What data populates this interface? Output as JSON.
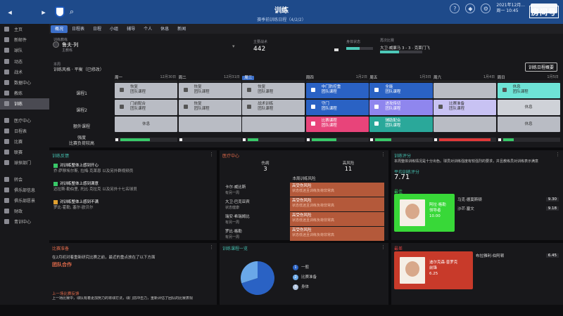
{
  "topbar": {
    "title": "训练",
    "subtitle": "赛季前训练日程（4/2/2）",
    "date_line1": "2021年12月...",
    "date_line2": "周一 10:45"
  },
  "watermark": {
    "line1": "房间号",
    "line2": "10298082"
  },
  "sidebar": {
    "items": [
      {
        "label": "主页",
        "active": false
      },
      {
        "label": "新邮件",
        "active": false
      },
      {
        "label": "球队",
        "active": false
      },
      {
        "label": "动态",
        "active": false
      },
      {
        "label": "战术",
        "active": false
      },
      {
        "label": "数据中心",
        "active": false
      },
      {
        "label": "教练",
        "active": false
      },
      {
        "label": "训练",
        "active": true
      },
      {
        "label": "医疗中心",
        "active": false
      },
      {
        "label": "日程表",
        "active": false
      },
      {
        "label": "比赛",
        "active": false
      },
      {
        "label": "联赛",
        "active": false
      },
      {
        "label": "球探部门",
        "active": false
      },
      {
        "label": "转会",
        "active": false
      },
      {
        "label": "俱乐部信息",
        "active": false
      },
      {
        "label": "俱乐部愿景",
        "active": false
      },
      {
        "label": "财政",
        "active": false
      },
      {
        "label": "青训中心",
        "active": false
      }
    ]
  },
  "tabs": [
    "概况",
    "日程表",
    "日程",
    "小组",
    "辅导",
    "个人",
    "休息",
    "新闻"
  ],
  "info": {
    "coach_label": "训练教练",
    "coach_name": "鲁夫·列",
    "coach_role": "主教练",
    "stars_label": "主要战术",
    "stars_value": "442",
    "cond_label": "身体状态",
    "match_label": "再次比赛",
    "match_text": "大卫·威廉马 3 - 3 · 克莱门飞",
    "match_score": "3 - 3"
  },
  "schedule": {
    "section_label": "本周",
    "title": "训练风格 · 平衡（已修改）",
    "calendar_button": "训练日程概要",
    "rows": [
      "课程1",
      "课程2",
      "额外课程"
    ],
    "intensity_label": "强度",
    "intensity_sub": "比赛负荷较高",
    "days": [
      {
        "name": "周一",
        "date": "12月30日",
        "today": false
      },
      {
        "name": "周二",
        "date": "12月31日",
        "today": false
      },
      {
        "name": "周三",
        "date": "",
        "today": true
      },
      {
        "name": "周四",
        "date": "1月2日",
        "today": false
      },
      {
        "name": "周五",
        "date": "1月3日",
        "today": false
      },
      {
        "name": "周六",
        "date": "1月4日",
        "today": false
      },
      {
        "name": "周日",
        "date": "1月5日",
        "today": false
      }
    ],
    "sessions": [
      {
        "row": 0,
        "day": 0,
        "style": "grey",
        "l1": "恢复",
        "l2": "团队课程"
      },
      {
        "row": 0,
        "day": 1,
        "style": "grey",
        "l1": "恢复",
        "l2": "团队课程"
      },
      {
        "row": 0,
        "day": 2,
        "style": "grey",
        "l1": "恢复",
        "l2": "团队课程"
      },
      {
        "row": 0,
        "day": 3,
        "style": "blue",
        "l1": "中门防控重",
        "l2": "团队课程"
      },
      {
        "row": 0,
        "day": 4,
        "style": "blue",
        "l1": "全能",
        "l2": "团队课程"
      },
      {
        "row": 0,
        "day": 5,
        "style": "grey",
        "l1": "",
        "l2": ""
      },
      {
        "row": 0,
        "day": 6,
        "style": "cyan",
        "l1": "休息",
        "l2": "团队课程"
      },
      {
        "row": 1,
        "day": 0,
        "style": "grey",
        "l1": "门前配合",
        "l2": "团队课程"
      },
      {
        "row": 1,
        "day": 1,
        "style": "grey",
        "l1": "恢复",
        "l2": "团队课程"
      },
      {
        "row": 1,
        "day": 2,
        "style": "grey",
        "l1": "战术训练",
        "l2": "团队课程"
      },
      {
        "row": 1,
        "day": 3,
        "style": "blue",
        "l1": "守门",
        "l2": "团队课程"
      },
      {
        "row": 1,
        "day": 4,
        "style": "lilac",
        "l1": "进攻传切",
        "l2": "团队课程"
      },
      {
        "row": 1,
        "day": 5,
        "style": "lavender",
        "l1": "比赛准备",
        "l2": "团队课程"
      },
      {
        "row": 1,
        "day": 6,
        "style": "lightgrey",
        "l1": "休息",
        "l2": ""
      },
      {
        "row": 2,
        "day": 0,
        "style": "grey",
        "l1": "休息",
        "l2": ""
      },
      {
        "row": 2,
        "day": 1,
        "style": "grey",
        "l1": "",
        "l2": ""
      },
      {
        "row": 2,
        "day": 2,
        "style": "grey",
        "l1": "",
        "l2": ""
      },
      {
        "row": 2,
        "day": 3,
        "style": "pink",
        "l1": "比赛课程",
        "l2": "团队课程"
      },
      {
        "row": 2,
        "day": 4,
        "style": "teal",
        "l1": "辅助配合",
        "l2": "团队课程"
      },
      {
        "row": 2,
        "day": 5,
        "style": "grey",
        "l1": "",
        "l2": ""
      },
      {
        "row": 2,
        "day": 6,
        "style": "grey",
        "l1": "休息",
        "l2": ""
      }
    ],
    "intensity": [
      {
        "level": 0.55,
        "color": "#38c868"
      },
      {
        "level": 0.0,
        "color": "#38c868"
      },
      {
        "level": 0.2,
        "color": "#38c868"
      },
      {
        "level": 0.45,
        "color": "#38c868"
      },
      {
        "level": 0.3,
        "color": "#38c868"
      },
      {
        "level": 0.95,
        "color": "#e03838"
      },
      {
        "level": 0.2,
        "color": "#38c868"
      }
    ]
  },
  "feedback": {
    "title": "训练反馈",
    "items": [
      {
        "title": "对训练整体上感到开心",
        "sub": "乔·萨穆埃尔斯, 拉梅·克莱恩 以及另外群视频员",
        "icon_color": "#38c868"
      },
      {
        "title": "对训练整体上感到满意",
        "sub": "达拉斯·勒伯里, 托比·克拉克 以及另外十七名球员",
        "icon_color": "#38c868"
      },
      {
        "title": "对训练整体上感到不满",
        "sub": "罗比·霍勒, 塞尔·欧贝尔",
        "icon_color": "#e0a030"
      }
    ]
  },
  "report": {
    "title": "医疗中心",
    "col1_head": "伤病",
    "col1_value": "3",
    "col2_head": "高风险",
    "col2_value": "11",
    "col2_sub": "本周训练风险",
    "rows": [
      {
        "name": "卡尔·威比斯",
        "sub": "有另一周",
        "risk": "高受伤风险",
        "risk_sub": "状态低迷且训练负荷非常高"
      },
      {
        "name": "大卫·巴克亚宾",
        "sub": "状态健康",
        "risk": "高受伤风险",
        "risk_sub": "状态低迷且训练负荷非常高"
      },
      {
        "name": "瑞安·希瑞姆比",
        "sub": "有另一周",
        "risk": "高受伤风险",
        "risk_sub": "状态低迷且训练负荷非常高"
      },
      {
        "name": "罗比·格勒",
        "sub": "有另一周",
        "risk": "高受伤风险",
        "risk_sub": "状态低迷且训练负荷非常高"
      }
    ]
  },
  "ratings": {
    "title": "训练评分",
    "desc": "本周整体训练情况是十分出色。球员对训练强度有较强烈的要求，并且教练员对训练表示满意",
    "avg_label": "平均训练评分",
    "avg_value": "7.71",
    "best_label": "最佳",
    "best_player": {
      "name": "阿拉·格勒",
      "sub": "领导者",
      "rating": "10.00"
    },
    "best_list": [
      {
        "name": "马克·德莫斯顿",
        "rating": "9.30"
      },
      {
        "name": "沙芒·塞文",
        "rating": "9.18"
      }
    ],
    "worst_label": "最差",
    "worst_player": {
      "name": "迪尔克森·普罗克",
      "sub": "前锋",
      "rating": "6.25"
    },
    "worst_list": [
      {
        "name": "布拉雅利·伯阿顿",
        "rating": "6.45"
      }
    ]
  },
  "advice": {
    "title": "比赛准备",
    "text": "在2月初对着重新研究比赛之前，最近的重点放在了以下方面",
    "focus": "团队合作",
    "last_title": "上一场比赛反馈",
    "last_text": "上一场比赛中，球队有着更加努力的将球打法，球门前冲击力，重新评估了团队的比赛表现"
  },
  "groups": {
    "title": "训练课程一览",
    "legend": [
      {
        "label": "一般",
        "color": "#2a62c4",
        "count": "1"
      },
      {
        "label": "比赛准备",
        "color": "#6aa8e8",
        "count": "2"
      },
      {
        "label": "身体",
        "color": "#b0c4e0",
        "count": "3"
      }
    ],
    "pie": [
      {
        "label": "一般",
        "value": 0.7,
        "color": "#2a62c4"
      },
      {
        "label": "比赛准备",
        "value": 0.3,
        "color": "#6aa8e8"
      }
    ]
  }
}
